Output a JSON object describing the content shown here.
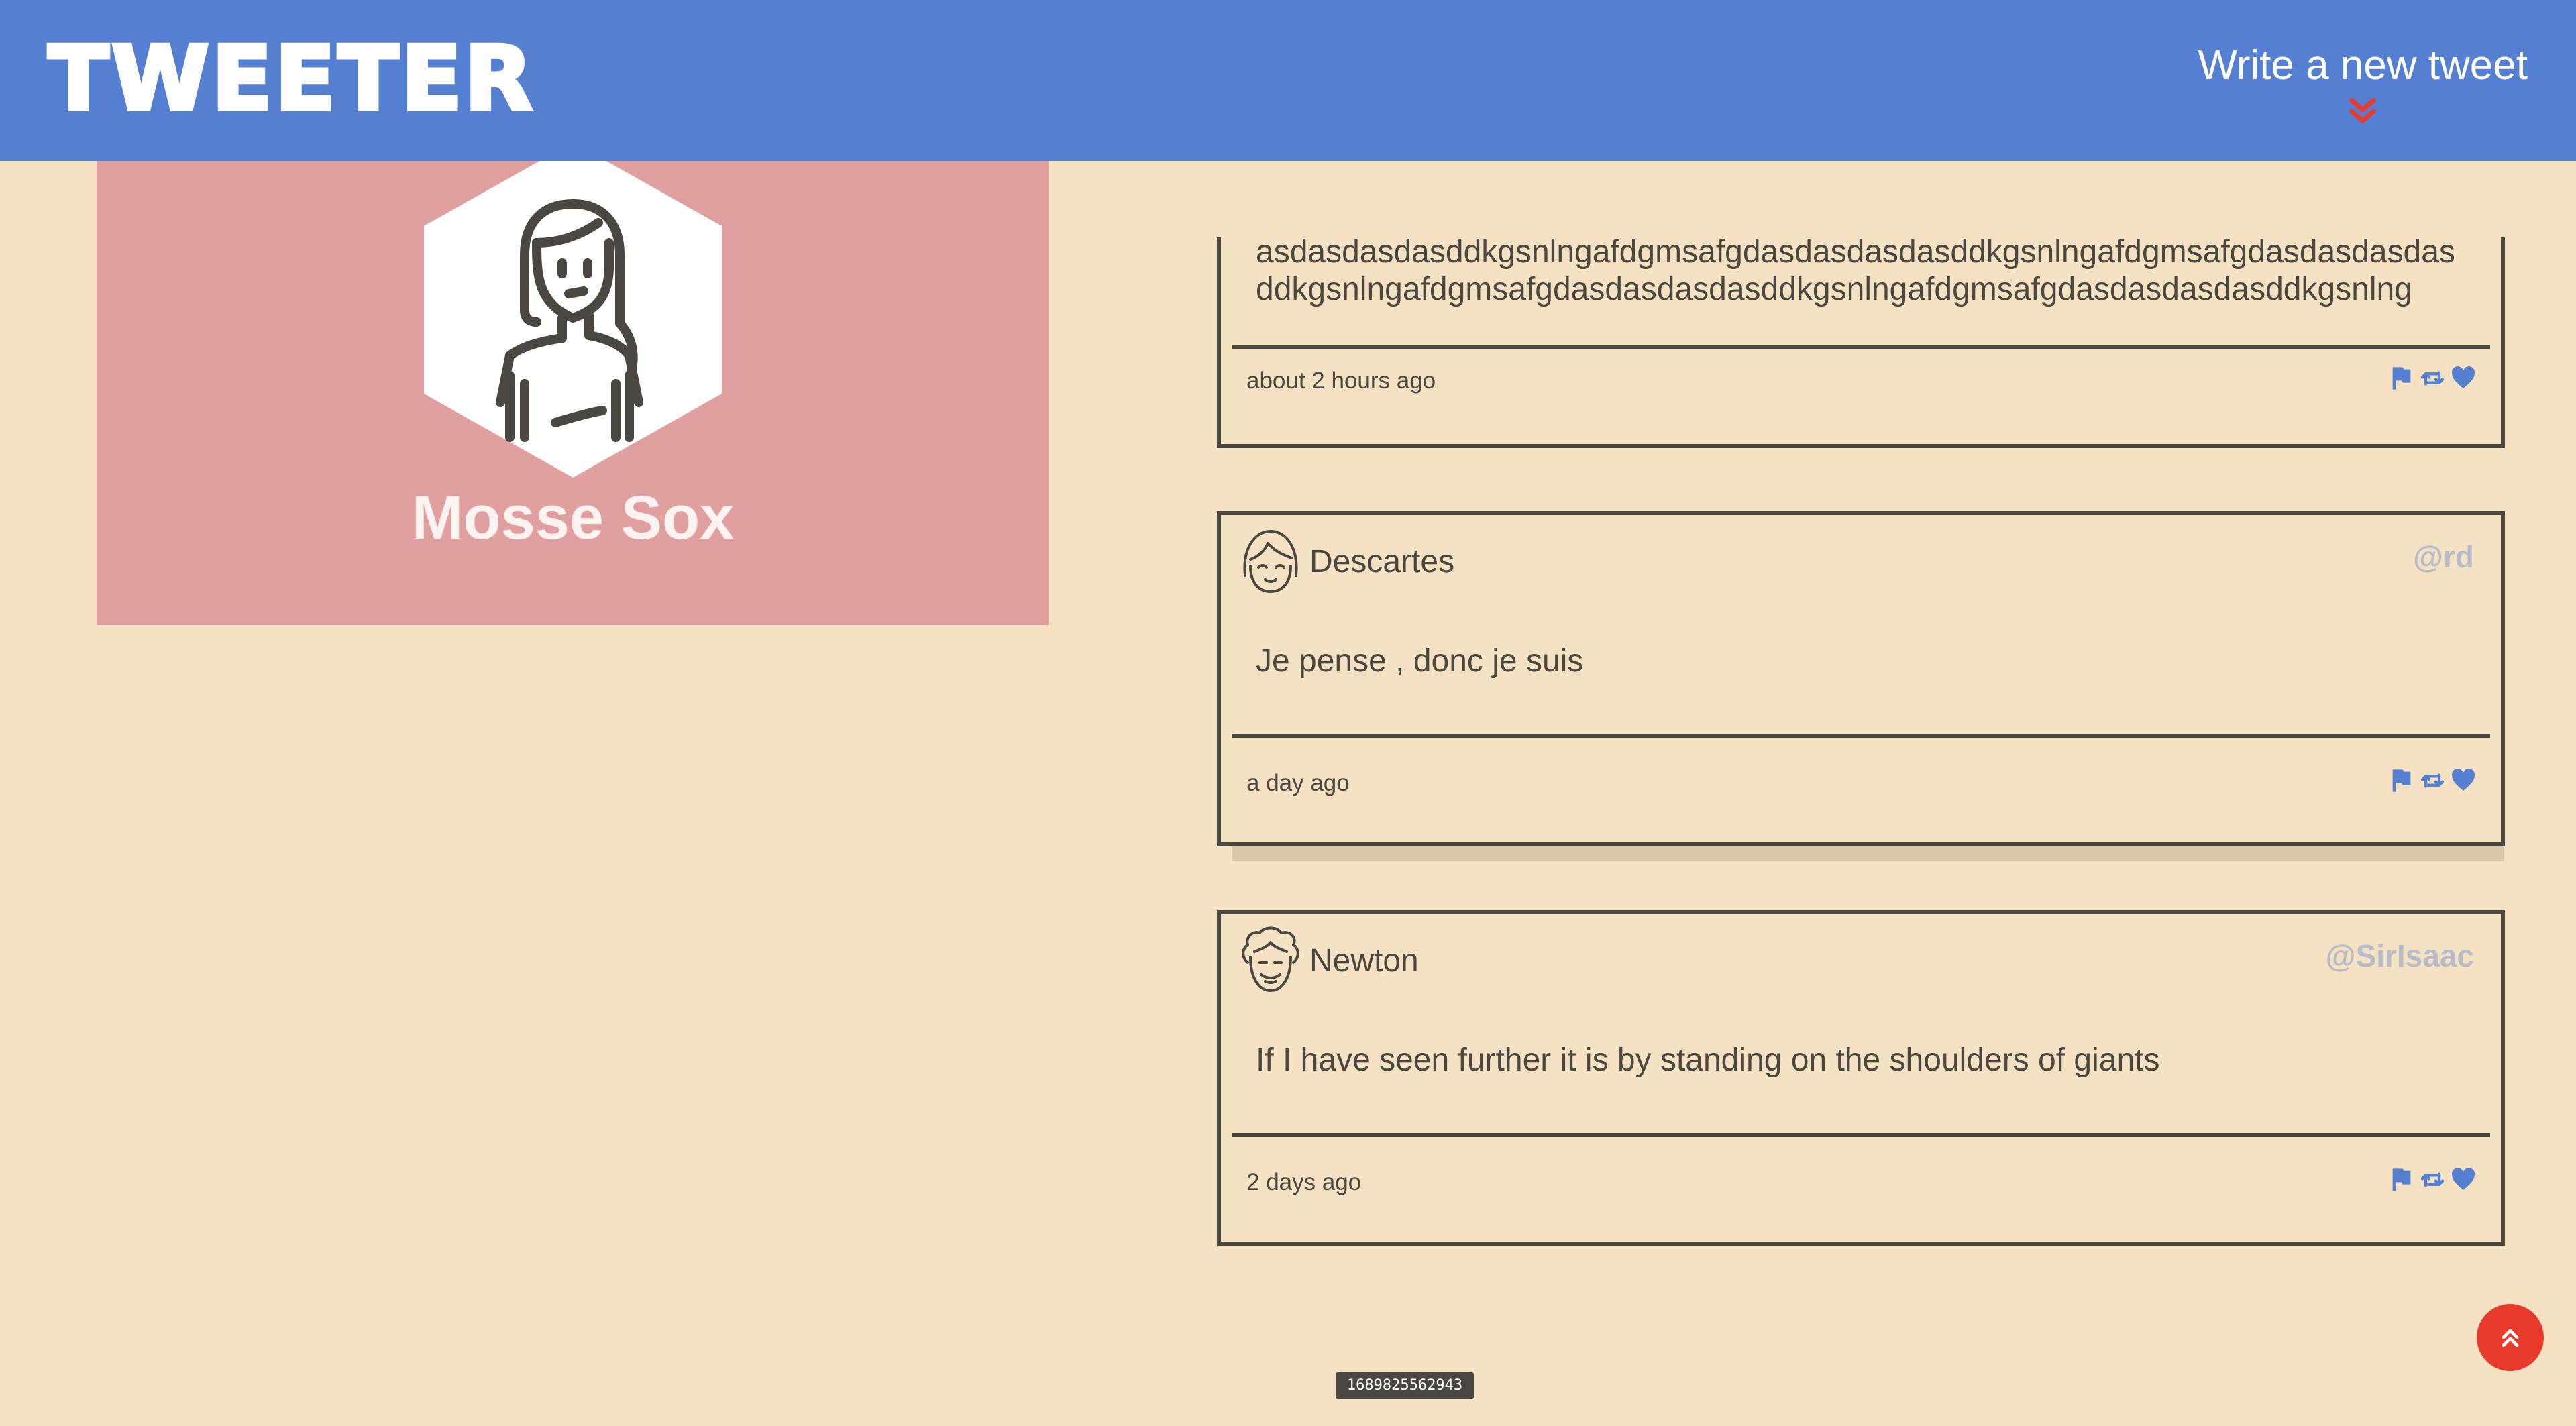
{
  "header": {
    "logo_text": "TWEETER",
    "compose_label": "Write a new tweet",
    "compose_icon": "double-chevron-down-icon",
    "compose_icon_color": "#e83a2a",
    "background_color": "#557fd1"
  },
  "profile": {
    "name": "Mosse Sox",
    "avatar_icon": "woman-avatar-icon",
    "background_color": "#e0a0a0"
  },
  "tweets": [
    {
      "user": "",
      "handle": "",
      "body": "asdasdasdasddkgsnlngafdgmsafgdasdasdasdasddkgsnlngafdgmsafgdasdasdasdasddkgsnlngafdgmsafgdasdasdasdasddkgsnlngafdgmsafgdasdasdasdasddkgsnlng",
      "time": "about 2 hours ago"
    },
    {
      "user": "Descartes",
      "handle": "@rd",
      "body": "Je pense , donc je suis",
      "time": "a day ago"
    },
    {
      "user": "Newton",
      "handle": "@SirIsaac",
      "body": "If I have seen further it is by standing on the shoulders of giants",
      "time": "2 days ago"
    }
  ],
  "actions": {
    "icons": [
      "flag-icon",
      "retweet-icon",
      "heart-icon"
    ],
    "color": "#557fd1"
  },
  "scroll_top": {
    "icon": "double-chevron-up-icon",
    "color": "#e83a2a"
  },
  "timestamp_badge": "1689825562943"
}
